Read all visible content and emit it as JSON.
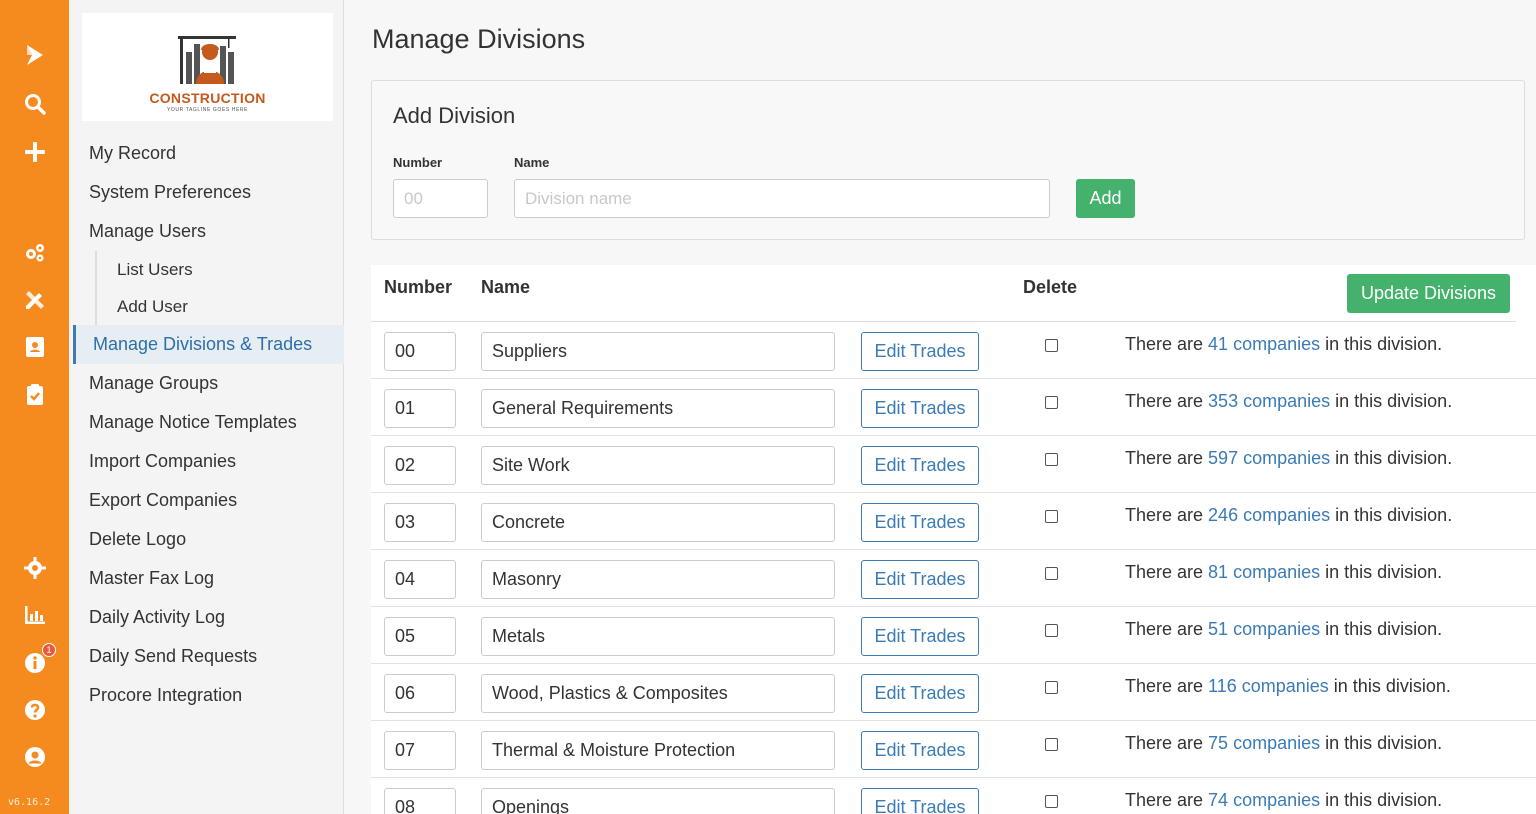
{
  "rail": {
    "icons": [
      "play-logo-icon",
      "search-icon",
      "plus-icon",
      "gears-icon",
      "pencil-ruler-icon",
      "contact-card-icon",
      "clipboard-check-icon",
      "gear-icon",
      "bar-chart-icon",
      "info-icon",
      "help-icon",
      "user-icon"
    ],
    "notification_count": "1",
    "version": "v6.16.2",
    "color": "#f58a1f"
  },
  "logo": {
    "name": "CONSTRUCTION",
    "tagline": "YOUR TAGLINE GOES HERE"
  },
  "sidebar": {
    "items": [
      {
        "label": "My Record"
      },
      {
        "label": "System Preferences"
      },
      {
        "label": "Manage Users"
      },
      {
        "label": "List Users"
      },
      {
        "label": "Add User"
      },
      {
        "label": "Manage Divisions & Trades"
      },
      {
        "label": "Manage Groups"
      },
      {
        "label": "Manage Notice Templates"
      },
      {
        "label": "Import Companies"
      },
      {
        "label": "Export Companies"
      },
      {
        "label": "Delete Logo"
      },
      {
        "label": "Master Fax Log"
      },
      {
        "label": "Daily Activity Log"
      },
      {
        "label": "Daily Send Requests"
      },
      {
        "label": "Procore Integration"
      }
    ],
    "active_index": 5
  },
  "page": {
    "title": "Manage Divisions"
  },
  "add_division": {
    "title": "Add Division",
    "number_label": "Number",
    "number_placeholder": "00",
    "name_label": "Name",
    "name_placeholder": "Division name",
    "add_label": "Add"
  },
  "table": {
    "headers": {
      "number": "Number",
      "name": "Name",
      "delete": "Delete"
    },
    "update_label": "Update Divisions",
    "edit_label": "Edit Trades",
    "info_prefix": "There are ",
    "info_suffix": " in this division.",
    "rows": [
      {
        "number": "00",
        "name": "Suppliers",
        "companies": "41 companies"
      },
      {
        "number": "01",
        "name": "General Requirements",
        "companies": "353 companies"
      },
      {
        "number": "02",
        "name": "Site Work",
        "companies": "597 companies"
      },
      {
        "number": "03",
        "name": "Concrete",
        "companies": "246 companies"
      },
      {
        "number": "04",
        "name": "Masonry",
        "companies": "81 companies"
      },
      {
        "number": "05",
        "name": "Metals",
        "companies": "51 companies"
      },
      {
        "number": "06",
        "name": "Wood, Plastics & Composites",
        "companies": "116 companies"
      },
      {
        "number": "07",
        "name": "Thermal & Moisture Protection",
        "companies": "75 companies"
      },
      {
        "number": "08",
        "name": "Openings",
        "companies": "74 companies"
      }
    ]
  },
  "colors": {
    "accent": "#3a7bb6",
    "success": "#44b26c",
    "brand": "#f58a1f"
  }
}
